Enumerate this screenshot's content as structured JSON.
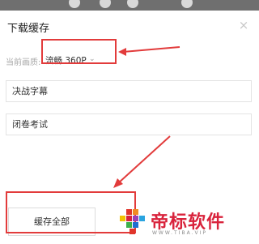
{
  "dialog": {
    "title": "下载缓存",
    "close_glyph": "×",
    "quality": {
      "label": "当前画质:",
      "value": "流畅 360P",
      "chevron": "⌄"
    },
    "episodes": [
      {
        "label": "决战字幕"
      },
      {
        "label": "闭卷考试"
      }
    ],
    "cache_all_label": "缓存全部"
  },
  "watermark": {
    "text": "帝标软件",
    "url": "WWW.TIBA.VIP"
  },
  "colors": {
    "annotation": "#e23b3b",
    "watermark": "#d9233c"
  }
}
